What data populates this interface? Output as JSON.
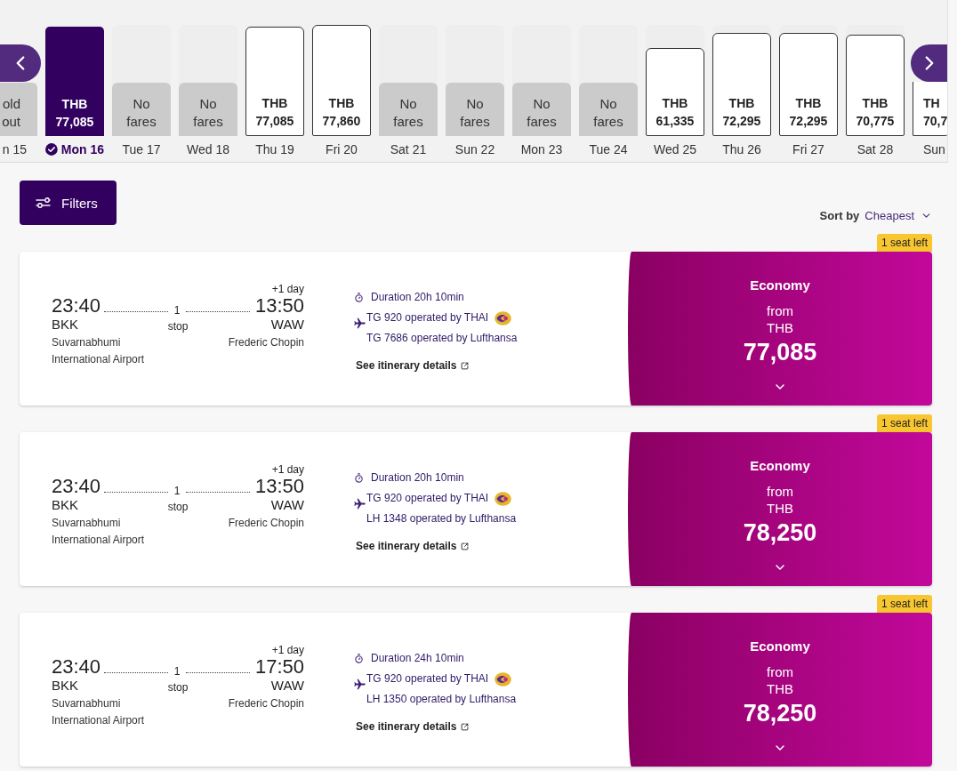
{
  "date_strip": {
    "days": [
      {
        "kind": "unavailable",
        "status": "old out",
        "label": "n 15",
        "selected": false,
        "level": 0.98
      },
      {
        "kind": "fare",
        "currency": "THB",
        "price": "77,085",
        "label": "Mon 16",
        "selected": true,
        "level": 0.98
      },
      {
        "kind": "unavailable",
        "status": "No fares",
        "label": "Tue 17",
        "selected": false,
        "level": 0.48
      },
      {
        "kind": "unavailable",
        "status": "No fares",
        "label": "Wed 18",
        "selected": false,
        "level": 0.48
      },
      {
        "kind": "fare",
        "currency": "THB",
        "price": "77,085",
        "label": "Thu 19",
        "selected": false,
        "level": 0.98
      },
      {
        "kind": "fare",
        "currency": "THB",
        "price": "77,860",
        "label": "Fri 20",
        "selected": false,
        "level": 1
      },
      {
        "kind": "unavailable",
        "status": "No fares",
        "label": "Sat 21",
        "selected": false,
        "level": 0.48
      },
      {
        "kind": "unavailable",
        "status": "No fares",
        "label": "Sun 22",
        "selected": false,
        "level": 0.48
      },
      {
        "kind": "unavailable",
        "status": "No fares",
        "label": "Mon 23",
        "selected": false,
        "level": 0.48
      },
      {
        "kind": "unavailable",
        "status": "No fares",
        "label": "Tue 24",
        "selected": false,
        "level": 0.48
      },
      {
        "kind": "fare",
        "currency": "THB",
        "price": "61,335",
        "label": "Wed 25",
        "selected": false,
        "level": 0.79
      },
      {
        "kind": "fare",
        "currency": "THB",
        "price": "72,295",
        "label": "Thu 26",
        "selected": false,
        "level": 0.93
      },
      {
        "kind": "fare",
        "currency": "THB",
        "price": "72,295",
        "label": "Fri 27",
        "selected": false,
        "level": 0.93
      },
      {
        "kind": "fare",
        "currency": "THB",
        "price": "70,775",
        "label": "Sat 28",
        "selected": false,
        "level": 0.91
      },
      {
        "kind": "fare",
        "currency": "TH",
        "price": "70,7",
        "label": "Sun",
        "selected": false,
        "level": 1
      }
    ]
  },
  "toolbar": {
    "filters_button": "Filters",
    "sort": {
      "label": "Sort by",
      "value": "Cheapest"
    }
  },
  "flights": [
    {
      "badge": "1 seat left",
      "departure": {
        "time": "23:40",
        "code": "BKK",
        "airport": "Suvarnabhumi International Airport"
      },
      "arrival": {
        "time": "13:50",
        "day_offset": "+1 day",
        "code": "WAW",
        "airport": "Frederic Chopin"
      },
      "stops": {
        "count": "1",
        "label": "stop"
      },
      "duration": "Duration 20h 10min",
      "segments": [
        {
          "text": "TG 920 operated by THAI",
          "logo": true
        },
        {
          "text": "TG 7686 operated by Lufthansa",
          "logo": false
        }
      ],
      "details_link": "See itinerary details",
      "fare": {
        "cabin": "Economy",
        "from": "from",
        "currency": "THB",
        "price": "77,085"
      }
    },
    {
      "badge": "1 seat left",
      "departure": {
        "time": "23:40",
        "code": "BKK",
        "airport": "Suvarnabhumi International Airport"
      },
      "arrival": {
        "time": "13:50",
        "day_offset": "+1 day",
        "code": "WAW",
        "airport": "Frederic Chopin"
      },
      "stops": {
        "count": "1",
        "label": "stop"
      },
      "duration": "Duration 20h 10min",
      "segments": [
        {
          "text": "TG 920 operated by THAI",
          "logo": true
        },
        {
          "text": "LH 1348 operated by Lufthansa",
          "logo": false
        }
      ],
      "details_link": "See itinerary details",
      "fare": {
        "cabin": "Economy",
        "from": "from",
        "currency": "THB",
        "price": "78,250"
      }
    },
    {
      "badge": "1 seat left",
      "departure": {
        "time": "23:40",
        "code": "BKK",
        "airport": "Suvarnabhumi International Airport"
      },
      "arrival": {
        "time": "17:50",
        "day_offset": "+1 day",
        "code": "WAW",
        "airport": "Frederic Chopin"
      },
      "stops": {
        "count": "1",
        "label": "stop"
      },
      "duration": "Duration 24h 10min",
      "segments": [
        {
          "text": "TG 920 operated by THAI",
          "logo": true
        },
        {
          "text": "LH 1350 operated by Lufthansa",
          "logo": false
        }
      ],
      "details_link": "See itinerary details",
      "fare": {
        "cabin": "Economy",
        "from": "from",
        "currency": "THB",
        "price": "78,250"
      }
    }
  ]
}
